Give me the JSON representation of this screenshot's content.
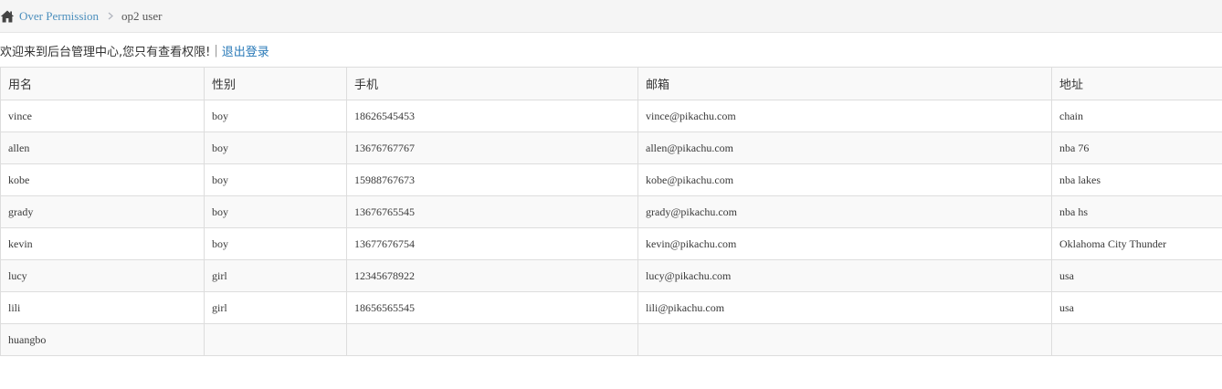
{
  "breadcrumb": {
    "home_icon": "home-icon",
    "parent": "Over Permission",
    "separator_icon": "chevron-right-icon",
    "current": "op2 user"
  },
  "welcome": {
    "message": "欢迎来到后台管理中心,您只有查看权限!",
    "separator": "|",
    "logout": "退出登录"
  },
  "table": {
    "columns": [
      "用名",
      "性别",
      "手机",
      "邮箱",
      "地址"
    ],
    "rows": [
      [
        "vince",
        "boy",
        "18626545453",
        "vince@pikachu.com",
        "chain"
      ],
      [
        "allen",
        "boy",
        "13676767767",
        "allen@pikachu.com",
        "nba 76"
      ],
      [
        "kobe",
        "boy",
        "15988767673",
        "kobe@pikachu.com",
        "nba lakes"
      ],
      [
        "grady",
        "boy",
        "13676765545",
        "grady@pikachu.com",
        "nba hs"
      ],
      [
        "kevin",
        "boy",
        "13677676754",
        "kevin@pikachu.com",
        "Oklahoma City Thunder"
      ],
      [
        "lucy",
        "girl",
        "12345678922",
        "lucy@pikachu.com",
        "usa"
      ],
      [
        "lili",
        "girl",
        "18656565545",
        "lili@pikachu.com",
        "usa"
      ],
      [
        "huangbo",
        "",
        "",
        "",
        ""
      ]
    ]
  },
  "colors": {
    "link": "#4c8fbd",
    "logout_link": "#2a7ab8",
    "border": "#dddddd",
    "stripe": "#f9f9f9",
    "breadcrumb_bg": "#f5f5f5"
  }
}
